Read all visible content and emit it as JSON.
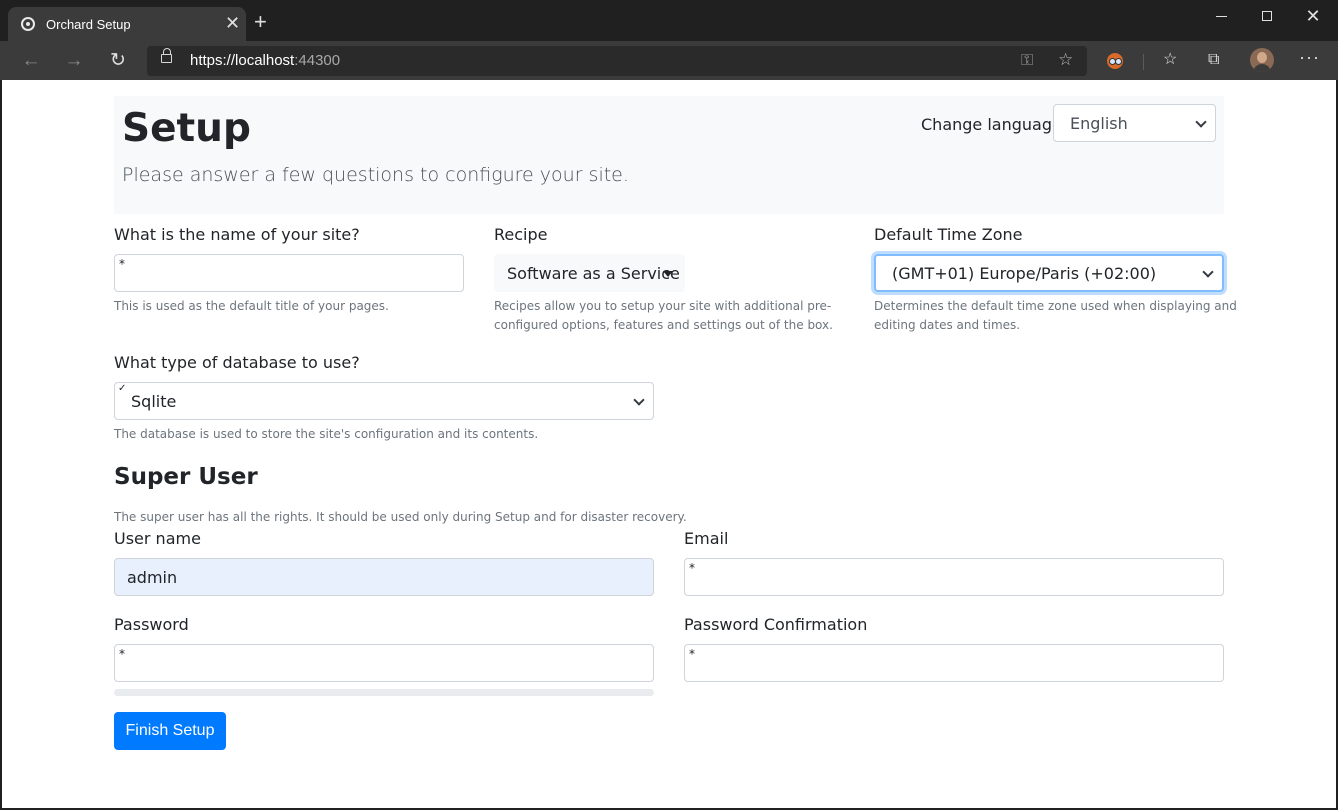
{
  "browser": {
    "tab_title": "Orchard Setup",
    "tab_close": "✕",
    "new_tab": "+",
    "url_main": "https://localhost",
    "url_port": ":44300",
    "window_controls": {
      "minimize": "",
      "maximize": "",
      "close": "✕"
    },
    "icons": [
      "back-arrow-icon",
      "forward-arrow-icon",
      "reload-icon",
      "lock-icon",
      "key-icon",
      "star-icon",
      "extension-icon",
      "favorites-icon",
      "collections-icon",
      "profile-avatar",
      "more-icon"
    ]
  },
  "header": {
    "title": "Setup",
    "lead": "Please answer a few questions to configure your site.",
    "language_label": "Change language",
    "language_value": "English"
  },
  "site": {
    "label": "What is the name of your site?",
    "value": "",
    "required_mark": "*",
    "help": "This is used as the default title of your pages."
  },
  "recipe": {
    "label": "Recipe",
    "value": "Software as a Service",
    "help_line1": "Recipes allow you to setup your site with additional pre-",
    "help_line2": "configured options, features and settings out of the box."
  },
  "timezone": {
    "label": "Default Time Zone",
    "value": "(GMT+01) Europe/Paris (+02:00)",
    "help_line1": "Determines the default time zone used when displaying and",
    "help_line2": "editing dates and times."
  },
  "database": {
    "label": "What type of database to use?",
    "value": "Sqlite",
    "check_mark": "✓",
    "help": "The database is used to store the site's configuration and its contents."
  },
  "super_user": {
    "title": "Super User",
    "help": "The super user has all the rights. It should be used only during Setup and for disaster recovery.",
    "username_label": "User name",
    "username_value": "admin",
    "email_label": "Email",
    "password_label": "Password",
    "password_confirm_label": "Password Confirmation",
    "required_mark": "*",
    "password_strength": 0
  },
  "actions": {
    "finish_label": "Finish Setup"
  },
  "colors": {
    "primary": "#007bff",
    "autofill": "#e8f0fe",
    "focus": "#80bdff"
  }
}
